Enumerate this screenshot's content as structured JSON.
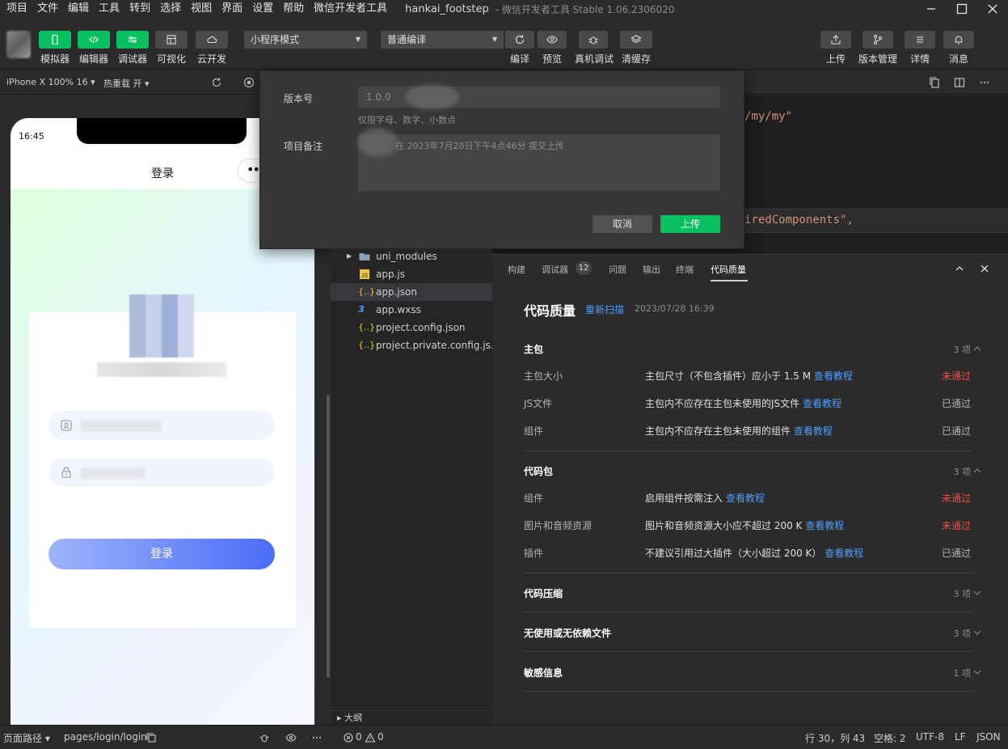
{
  "menubar": {
    "items": [
      "项目",
      "文件",
      "编辑",
      "工具",
      "转到",
      "选择",
      "视图",
      "界面",
      "设置",
      "帮助",
      "微信开发者工具"
    ],
    "title": "hankai_footstep",
    "subtitle": "- 微信开发者工具 Stable 1.06.2306020"
  },
  "toolbar": {
    "simulator": "模拟器",
    "editor": "编辑器",
    "debugger": "调试器",
    "visual": "可视化",
    "cloud": "云开发",
    "mode_select": "小程序模式",
    "compile_select": "普通编译",
    "compile": "编译",
    "preview": "预览",
    "real_debug": "真机调试",
    "clear_cache": "清缓存",
    "upload": "上传",
    "version_mgmt": "版本管理",
    "details": "详情",
    "messages": "消息"
  },
  "simulator": {
    "device": "iPhone X 100% 16 ▾",
    "hotreload": "热重载 开 ▾",
    "time": "16:45",
    "nav_title": "登录",
    "capsule": "••",
    "login_button": "登录"
  },
  "dialog": {
    "version_label": "版本号",
    "version_value": "1.0.0",
    "version_hint": "仅限字母、数字、小数点",
    "note_label": "项目备注",
    "note_value": "在 2023年7月28日下午4点46分 提交上传",
    "cancel": "取消",
    "upload": "上传"
  },
  "code": {
    "line1": "/my/my\"",
    "line2": "iredComponents\","
  },
  "tree": {
    "items": [
      {
        "name": "uni_modules",
        "icon": "folder-icon"
      },
      {
        "name": "app.js",
        "icon": "js-icon"
      },
      {
        "name": "app.json",
        "icon": "json-icon"
      },
      {
        "name": "app.wxss",
        "icon": "css-icon"
      },
      {
        "name": "project.config.json",
        "icon": "json-icon"
      },
      {
        "name": "project.private.config.js...",
        "icon": "json-icon"
      }
    ],
    "outline": "大纲"
  },
  "panel": {
    "tabs": [
      "构建",
      "调试器",
      "问题",
      "输出",
      "终端",
      "代码质量"
    ],
    "debugger_badge": "12",
    "title": "代码质量",
    "rescan": "重新扫描",
    "date": "2023/07/28 16:39",
    "sections": [
      {
        "title": "主包",
        "count": "3 项",
        "rows": [
          {
            "name": "主包大小",
            "desc": "主包尺寸（不包含插件）应小于 1.5 M",
            "link": "查看教程",
            "status": "未通过"
          },
          {
            "name": "JS文件",
            "desc": "主包内不应存在主包未使用的JS文件",
            "link": "查看教程",
            "status": "已通过"
          },
          {
            "name": "组件",
            "desc": "主包内不应存在主包未使用的组件",
            "link": "查看教程",
            "status": "已通过"
          }
        ]
      },
      {
        "title": "代码包",
        "count": "3 项",
        "rows": [
          {
            "name": "组件",
            "desc": "启用组件按需注入",
            "link": "查看教程",
            "status": "未通过"
          },
          {
            "name": "图片和音频资源",
            "desc": "图片和音频资源大小应不超过 200 K",
            "link": "查看教程",
            "status": "未通过"
          },
          {
            "name": "插件",
            "desc": "不建议引用过大插件（大小超过 200 K）",
            "link": "查看教程",
            "status": "已通过"
          }
        ]
      },
      {
        "title": "代码压缩",
        "count": "3 项"
      },
      {
        "title": "无使用或无依赖文件",
        "count": "3 项"
      },
      {
        "title": "敏感信息",
        "count": "1 项"
      }
    ]
  },
  "statusbar": {
    "page_path_label": "页面路径 ▾",
    "page_path": "pages/login/login",
    "errors": "0",
    "warnings": "0",
    "position": "行 30，列 43",
    "spaces": "空格: 2",
    "encoding": "UTF-8",
    "eol": "LF",
    "language": "JSON"
  },
  "colors": {
    "accent_green": "#07c160",
    "link_blue": "#4f9dff",
    "fail_red": "#f54a45"
  }
}
